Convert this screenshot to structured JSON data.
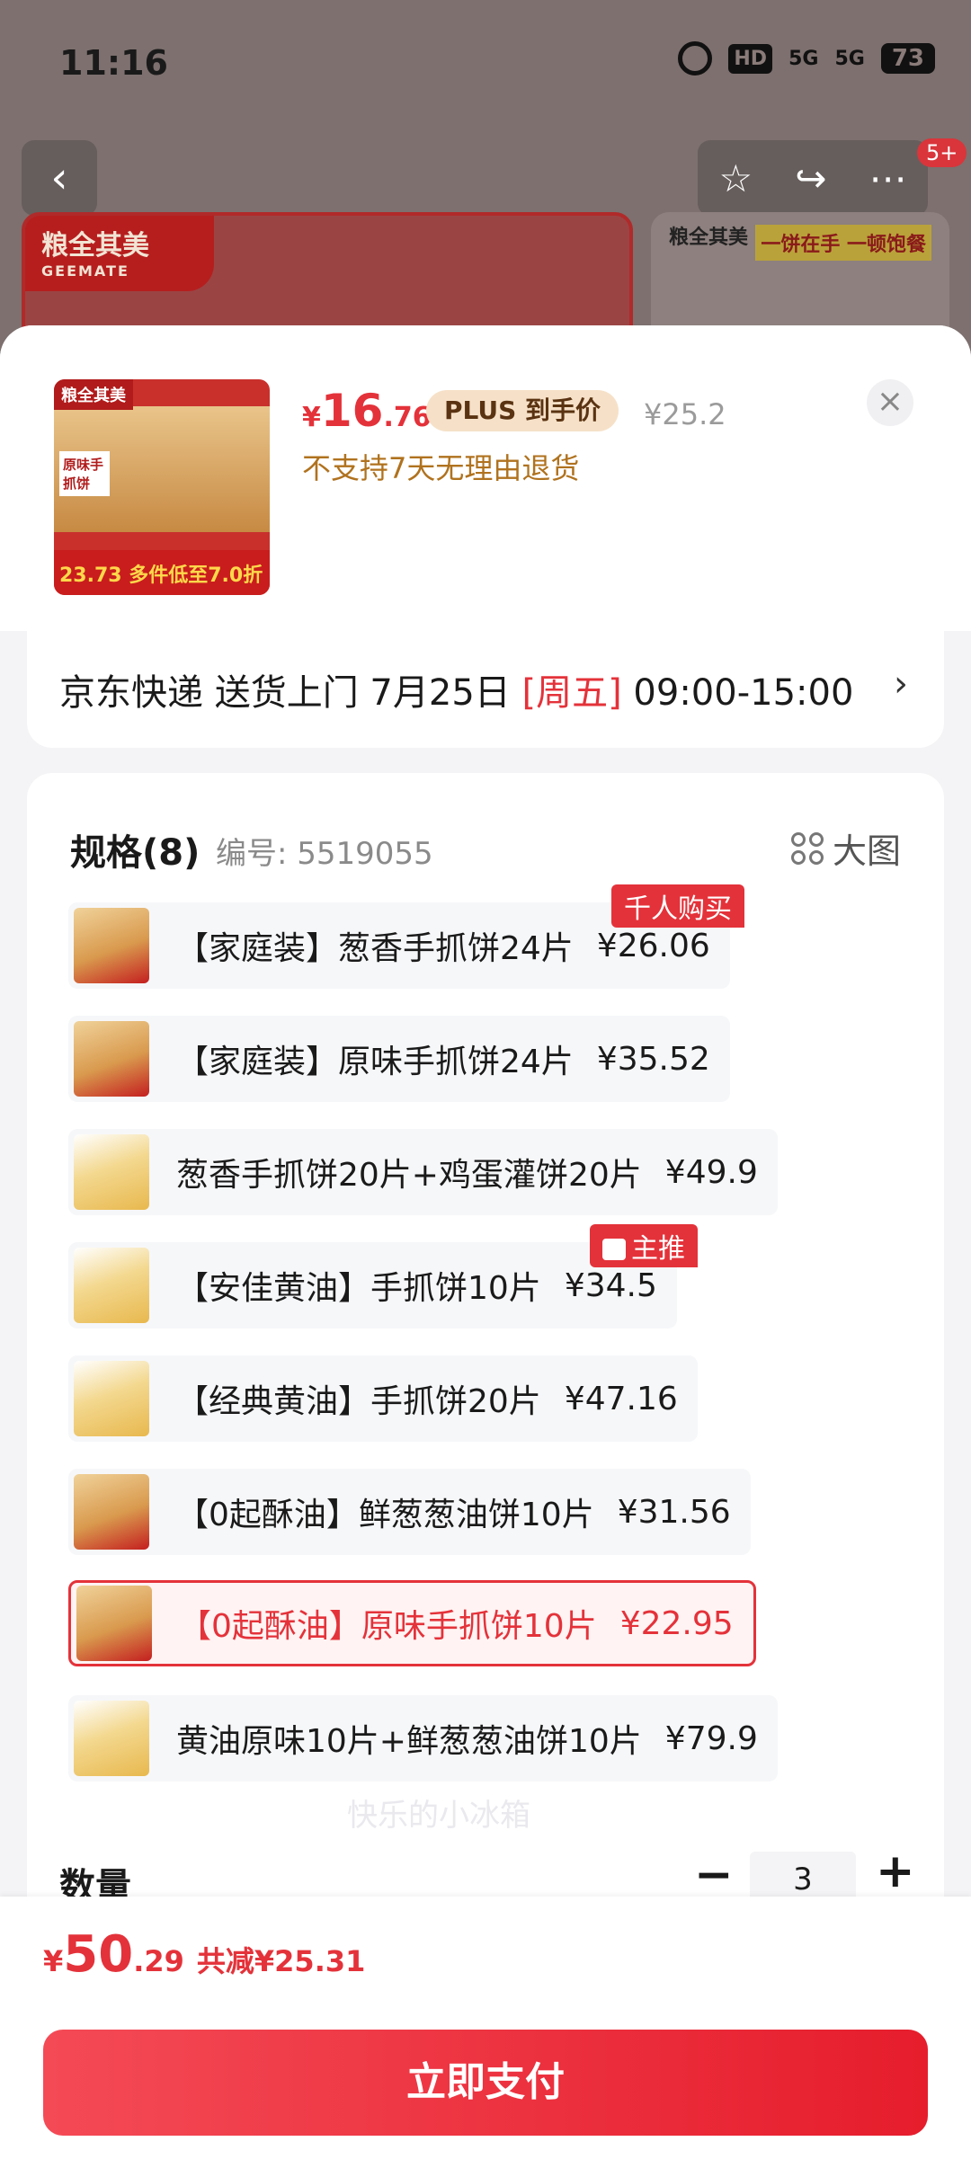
{
  "status_bar": {
    "time": "11:16",
    "hd": "HD",
    "signal1": "5G",
    "signal2": "5G",
    "battery": "73"
  },
  "background": {
    "banner1_brand": "粮全其美",
    "banner1_brand_en": "GEEMATE",
    "banner2_brand": "粮全其美",
    "banner2_title": "一饼在手 一顿饱餐",
    "message_badge": "5+"
  },
  "product": {
    "price_currency": "¥",
    "price_int": "16",
    "price_dec": ".76",
    "plus_tag": "PLUS 到手价",
    "original_price": "¥25.2",
    "return_note": "不支持7天无理由退货",
    "thumb_brand": "粮全其美",
    "thumb_label": "原味手抓饼",
    "thumb_price": "23.73 多件低至7.0折"
  },
  "delivery": {
    "text_pre": "京东快递 送货上门 7月25日 ",
    "weekday": "[周五]",
    "text_post": " 09:00-15:00",
    "arrow": "›"
  },
  "spec": {
    "title": "规格(8)",
    "code": "编号: 5519055",
    "bigpic_label": "大图",
    "options": [
      {
        "label": "【家庭装】葱香手抓饼24片",
        "price": "¥26.06",
        "badge": "千人购买"
      },
      {
        "label": "【家庭装】原味手抓饼24片",
        "price": "¥35.52"
      },
      {
        "label": "葱香手抓饼20片+鸡蛋灌饼20片",
        "price": "¥49.9"
      },
      {
        "label": "【安佳黄油】手抓饼10片",
        "price": "¥34.5",
        "badge": "主推"
      },
      {
        "label": "【经典黄油】手抓饼20片",
        "price": "¥47.16"
      },
      {
        "label": "【0起酥油】鲜葱葱油饼10片",
        "price": "¥31.56"
      },
      {
        "label": "【0起酥油】原味手抓饼10片",
        "price": "¥22.95",
        "selected": true
      },
      {
        "label": "黄油原味10片+鲜葱葱油饼10片",
        "price": "¥79.9"
      }
    ],
    "watermark": "快乐的小冰箱"
  },
  "quantity": {
    "label": "数量",
    "minus": "−",
    "value": "3",
    "plus": "+"
  },
  "footer": {
    "currency": "¥",
    "total_int": "50",
    "total_dec": ".29",
    "saving": "共减¥25.31",
    "pay_label": "立即支付"
  },
  "colors": {
    "accent": "#e4323a",
    "plus_bg": "#f6e1c8",
    "return_note": "#b0721e"
  }
}
